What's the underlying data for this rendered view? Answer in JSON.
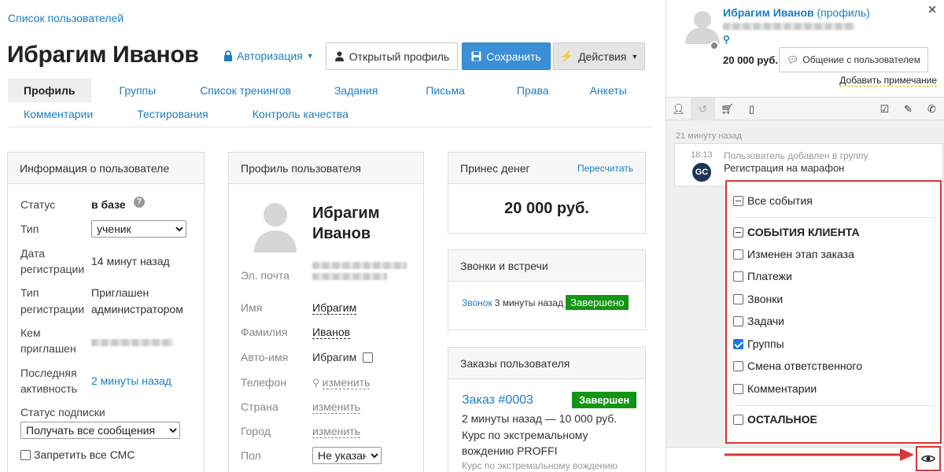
{
  "breadcrumb": "Список пользователей",
  "page_title": "Ибрагим Иванов",
  "auth_label": "Авторизация",
  "buttons": {
    "open_profile": "Открытый профиль",
    "save": "Сохранить",
    "actions": "Действия"
  },
  "tabs_row1": [
    "Профиль",
    "Группы",
    "Список тренингов",
    "Задания",
    "Письма",
    "Права",
    "Анкеты"
  ],
  "tabs_row2": [
    "Комментарии",
    "Тестирования",
    "Контроль качества"
  ],
  "info_panel": {
    "title": "Информация о пользователе",
    "status_label": "Статус",
    "status_value": "в базе",
    "type_label": "Тип",
    "type_value": "ученик",
    "reg_date_label_1": "Дата",
    "reg_date_label_2": "регистрации",
    "reg_date_value": "14 минут назад",
    "reg_type_label_1": "Тип",
    "reg_type_label_2": "регистрации",
    "reg_type_value_1": "Приглашен",
    "reg_type_value_2": "администратором",
    "invited_label_1": "Кем",
    "invited_label_2": "приглашен",
    "last_label_1": "Последняя",
    "last_label_2": "активность",
    "last_value": "2 минуты назад",
    "sub_label": "Статус подписки",
    "sub_value": "Получать все сообщения",
    "sms_label": "Запретить все СМС"
  },
  "profile_panel": {
    "title": "Профиль пользователя",
    "name_line1": "Ибрагим",
    "name_line2": "Иванов",
    "email_label": "Эл. почта",
    "first_name_label": "Имя",
    "first_name_value": "Ибрагим",
    "last_name_label": "Фамилия",
    "last_name_value": "Иванов",
    "auto_name_label": "Авто-имя",
    "auto_name_value": "Ибрагим",
    "phone_label": "Телефон",
    "change": "изменить",
    "country_label": "Страна",
    "city_label": "Город",
    "gender_label": "Пол",
    "gender_value": "Не указан"
  },
  "money_panel": {
    "title": "Принес денег",
    "recalc": "Пересчитать",
    "amount": "20 000 руб."
  },
  "calls_panel": {
    "title": "Звонки и встречи",
    "call_link": "Звонок",
    "call_time": "3 минуты назад",
    "status": "Завершено"
  },
  "orders_panel": {
    "title": "Заказы пользователя",
    "order_link": "Заказ #0003",
    "order_status": "Завершен",
    "order_line": "2 минуты назад — 10 000 руб.",
    "course_line1": "Курс по экстремальному",
    "course_line2": "вождению PROFFI",
    "course_gray": "Курс по экстремальному вождению"
  },
  "sidebar": {
    "user_name": "Ибрагим Иванов",
    "profile_link": "(профиль)",
    "amount": "20 000 руб.",
    "chat_button": "Общение с пользователем",
    "add_note": "Добавить примечание",
    "time_ago": "21 минуту назад",
    "event_time": "18:13",
    "event_title": "Пользователь добавлен в группу",
    "event_group": "Регистрация на марафон",
    "avatar_text": "GC"
  },
  "filter": {
    "all_events": "Все события",
    "client_events": "СОБЫТИЯ КЛИЕНТА",
    "items": [
      "Изменен этап заказа",
      "Платежи",
      "Звонки",
      "Задачи",
      "Группы",
      "Смена ответственного",
      "Комментарии"
    ],
    "other": "ОСТАЛЬНОЕ"
  },
  "colors": {
    "accent": "#1b7ec4",
    "save_button": "#3a8fd6",
    "success": "#149414",
    "highlight": "#d93535"
  }
}
